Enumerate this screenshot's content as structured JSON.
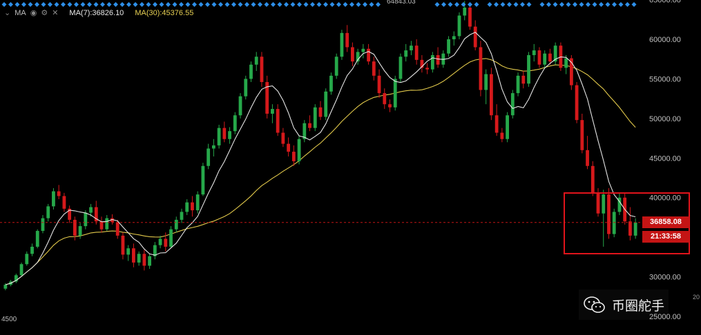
{
  "legend": {
    "symbol_label": "MA",
    "ma7_label": "MA(7):36826.10",
    "ma30_label": "MA(30):45376.55"
  },
  "current_price": "36858.08",
  "countdown": "21:33:58",
  "peak_label": "64843.03",
  "left_label": "4500",
  "watermark_text": "币圈舵手",
  "edge_label": "20",
  "colors": {
    "up": "#26a84a",
    "down": "#d5191b",
    "ma7": "#e6e6e6",
    "ma30": "#e2c94b",
    "price_line": "#c41414",
    "highlight_box": "#e1141b",
    "marker": "#2e8fe8"
  },
  "chart_data": {
    "type": "candlestick",
    "title": "",
    "xlabel": "",
    "ylabel": "",
    "y_ticks": [
      25000,
      30000,
      35000,
      40000,
      45000,
      50000,
      55000,
      60000,
      65000
    ],
    "ylim": [
      24500,
      65400
    ],
    "grid": false,
    "current_price": 36858.08,
    "series": [
      {
        "name": "MA(7)",
        "last": 36826.1
      },
      {
        "name": "MA(30)",
        "last": 45376.55
      }
    ],
    "candles_ohlc": [
      [
        28500,
        29200,
        28300,
        29000
      ],
      [
        29000,
        29600,
        28800,
        29400
      ],
      [
        29400,
        30400,
        29200,
        30200
      ],
      [
        30200,
        31800,
        30000,
        31600
      ],
      [
        31600,
        33200,
        31400,
        32900
      ],
      [
        32900,
        34200,
        32600,
        33800
      ],
      [
        33800,
        36000,
        33600,
        35800
      ],
      [
        35800,
        37800,
        35500,
        37400
      ],
      [
        37400,
        39200,
        37000,
        38900
      ],
      [
        38900,
        41200,
        38500,
        40800
      ],
      [
        40800,
        41600,
        39800,
        40200
      ],
      [
        40200,
        40600,
        38200,
        38600
      ],
      [
        38600,
        39000,
        36800,
        37200
      ],
      [
        37200,
        37600,
        34600,
        35200
      ],
      [
        35200,
        36800,
        34800,
        36400
      ],
      [
        36400,
        38400,
        36000,
        38100
      ],
      [
        38100,
        39200,
        37600,
        38800
      ],
      [
        38800,
        39600,
        36600,
        37000
      ],
      [
        37000,
        37600,
        35600,
        36000
      ],
      [
        36000,
        37800,
        35800,
        37400
      ],
      [
        37400,
        37900,
        36600,
        36900
      ],
      [
        36900,
        37200,
        34800,
        35200
      ],
      [
        35200,
        35600,
        32200,
        32800
      ],
      [
        32800,
        34000,
        32000,
        33600
      ],
      [
        33600,
        34200,
        31200,
        31800
      ],
      [
        31800,
        33200,
        31400,
        32900
      ],
      [
        32900,
        33400,
        30800,
        31400
      ],
      [
        31400,
        32900,
        31000,
        32600
      ],
      [
        32600,
        34400,
        32200,
        34000
      ],
      [
        34000,
        35200,
        33600,
        34800
      ],
      [
        34800,
        35600,
        33200,
        33800
      ],
      [
        33800,
        36400,
        33600,
        36000
      ],
      [
        36000,
        37600,
        35600,
        37200
      ],
      [
        37200,
        38600,
        36800,
        38200
      ],
      [
        38200,
        39800,
        37800,
        39400
      ],
      [
        39400,
        40200,
        37600,
        38400
      ],
      [
        38400,
        40800,
        38000,
        40400
      ],
      [
        40400,
        44400,
        40200,
        44000
      ],
      [
        44000,
        46800,
        43600,
        46200
      ],
      [
        46200,
        47400,
        45200,
        46600
      ],
      [
        46600,
        49200,
        46200,
        48800
      ],
      [
        48800,
        49600,
        47000,
        47400
      ],
      [
        47400,
        48900,
        46800,
        48400
      ],
      [
        48400,
        50800,
        48000,
        50400
      ],
      [
        50400,
        53200,
        50000,
        52800
      ],
      [
        52800,
        55400,
        52400,
        55000
      ],
      [
        55000,
        57200,
        54600,
        56800
      ],
      [
        56800,
        58400,
        56000,
        57800
      ],
      [
        57800,
        58400,
        54000,
        54600
      ],
      [
        54600,
        55400,
        50000,
        50600
      ],
      [
        50600,
        51800,
        49400,
        51200
      ],
      [
        51200,
        51800,
        47800,
        48200
      ],
      [
        48200,
        48800,
        46400,
        46800
      ],
      [
        46800,
        47600,
        45200,
        45800
      ],
      [
        45800,
        46600,
        44000,
        44600
      ],
      [
        44600,
        47800,
        44200,
        47400
      ],
      [
        47400,
        49800,
        47000,
        49400
      ],
      [
        49400,
        50400,
        48400,
        48800
      ],
      [
        48800,
        51800,
        48400,
        51400
      ],
      [
        51400,
        52200,
        49800,
        50200
      ],
      [
        50200,
        53800,
        49800,
        53400
      ],
      [
        53400,
        55800,
        53000,
        55400
      ],
      [
        55400,
        58200,
        55000,
        57800
      ],
      [
        57800,
        61200,
        57400,
        60800
      ],
      [
        60800,
        61800,
        58400,
        59000
      ],
      [
        59000,
        59600,
        56600,
        57200
      ],
      [
        57200,
        58800,
        56800,
        58400
      ],
      [
        58400,
        59400,
        57600,
        58800
      ],
      [
        58800,
        59400,
        56800,
        57200
      ],
      [
        57200,
        57800,
        54800,
        55400
      ],
      [
        55400,
        56200,
        52600,
        53200
      ],
      [
        53200,
        53800,
        51200,
        51800
      ],
      [
        51800,
        52400,
        50800,
        51400
      ],
      [
        51400,
        55400,
        51000,
        55000
      ],
      [
        55000,
        58200,
        54600,
        57800
      ],
      [
        57800,
        59400,
        57200,
        58600
      ],
      [
        58600,
        59800,
        58000,
        59200
      ],
      [
        59200,
        60000,
        56800,
        57400
      ],
      [
        57400,
        58000,
        55800,
        56400
      ],
      [
        56400,
        57000,
        55600,
        56200
      ],
      [
        56200,
        58400,
        55800,
        58000
      ],
      [
        58000,
        59000,
        56400,
        56800
      ],
      [
        56800,
        58600,
        56400,
        58200
      ],
      [
        58200,
        60400,
        57800,
        60000
      ],
      [
        60000,
        61000,
        59200,
        60400
      ],
      [
        60400,
        63400,
        60000,
        63000
      ],
      [
        63000,
        64843,
        62400,
        64000
      ],
      [
        64000,
        64600,
        61200,
        61600
      ],
      [
        61600,
        62400,
        58600,
        59000
      ],
      [
        59000,
        59800,
        52800,
        53600
      ],
      [
        53600,
        56200,
        51800,
        55600
      ],
      [
        55600,
        56400,
        49800,
        50400
      ],
      [
        50400,
        51800,
        47800,
        48200
      ],
      [
        48200,
        48800,
        47000,
        47400
      ],
      [
        47400,
        50800,
        47000,
        50400
      ],
      [
        50400,
        53600,
        50000,
        53200
      ],
      [
        53200,
        55800,
        52800,
        55400
      ],
      [
        55400,
        56000,
        53800,
        54400
      ],
      [
        54400,
        58400,
        54000,
        58000
      ],
      [
        58000,
        59400,
        57200,
        58600
      ],
      [
        58600,
        59000,
        56400,
        56800
      ],
      [
        56800,
        58600,
        56400,
        58200
      ],
      [
        58200,
        58800,
        56800,
        57200
      ],
      [
        57200,
        59600,
        56800,
        59200
      ],
      [
        59200,
        59600,
        56000,
        56400
      ],
      [
        56400,
        58000,
        55600,
        57600
      ],
      [
        57600,
        58000,
        53600,
        54200
      ],
      [
        54200,
        54600,
        49400,
        49800
      ],
      [
        49800,
        50600,
        45600,
        46000
      ],
      [
        46000,
        47800,
        43600,
        44000
      ],
      [
        44000,
        44600,
        40200,
        40600
      ],
      [
        40600,
        41200,
        37600,
        38000
      ],
      [
        38000,
        41000,
        33800,
        40400
      ],
      [
        40400,
        41200,
        34800,
        35400
      ],
      [
        35400,
        38600,
        35000,
        38200
      ],
      [
        38200,
        40600,
        37800,
        40000
      ],
      [
        40000,
        40600,
        36600,
        37000
      ],
      [
        37000,
        38800,
        34600,
        35200
      ],
      [
        35200,
        37400,
        34800,
        36858
      ]
    ]
  }
}
